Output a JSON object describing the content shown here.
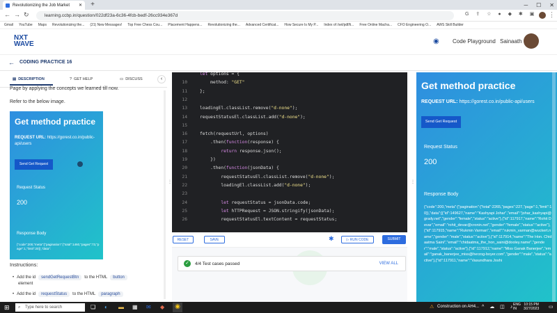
{
  "browser": {
    "tab_title": "Revolutionizing the Job Market",
    "url": "learning.ccbp.in/question/022df23a-6c36-4fcb-bedf-26cc934e367d",
    "bookmarks": [
      "Gmail",
      "YouTube",
      "Maps",
      "Revolutionizing the...",
      "(21) New Messages!",
      "Top Free Chess Cou...",
      "Placement Happens...",
      "Revolutionizing the...",
      "Advanced Certificat...",
      "How Secure Is My P...",
      "Index of /sel/pdf/li...",
      "Free Online Macha...",
      "CFO Engineering O...",
      "AWS Skill Builder"
    ]
  },
  "header": {
    "logo_top": "NXT",
    "logo_bottom": "WAVE",
    "code_playground": "Code Playground",
    "username": "Sainaath"
  },
  "practice_title": "CODING PRACTICE 16",
  "left_tabs": [
    "DESCRIPTION",
    "GET HELP",
    "DISCUSS"
  ],
  "left_panel": {
    "line1": "Page by applying the concepts we learned till now.",
    "line2": "Refer to the below image.",
    "preview": {
      "title": "Get method practice",
      "req_label": "REQUEST URL:",
      "req_url": "https://gorest.co.in/public-api/users",
      "button": "Send Get Request",
      "status_label": "Request Status",
      "status": "200",
      "body_label": "Response Body",
      "body": "{\"code\":200,\"meta\":{\"pagination\":{\"total\":1460,\"pages\":73,\"page\":1,\"limit\":20}},\"data\":"
    },
    "instructions_heading": "Instructions:",
    "inst1_a": "Add the id",
    "inst1_code": "sendGetRequestBtn",
    "inst1_b": "to the HTML",
    "inst1_code2": "button",
    "inst1_c": "element",
    "inst2_a": "Add the id",
    "inst2_code": "requestStatus",
    "inst2_b": "to the HTML",
    "inst2_code2": "paragraph"
  },
  "editor": {
    "lines": [
      {
        "n": "",
        "t": "let options = {"
      },
      {
        "n": "10",
        "t": "    method: \"GET\""
      },
      {
        "n": "11",
        "t": "};"
      },
      {
        "n": "12",
        "t": ""
      },
      {
        "n": "13",
        "t": "loadingEl.classList.remove(\"d-none\");"
      },
      {
        "n": "14",
        "t": "requestStatusEl.classList.add(\"d-none\");"
      },
      {
        "n": "15",
        "t": ""
      },
      {
        "n": "16",
        "t": "fetch(requestUrl, options)"
      },
      {
        "n": "17",
        "t": "    .then(function(response) {"
      },
      {
        "n": "18",
        "t": "        return response.json();"
      },
      {
        "n": "19",
        "t": "    })"
      },
      {
        "n": "20",
        "t": "    .then(function(jsonData) {"
      },
      {
        "n": "21",
        "t": "        requestStatusEl.classList.remove(\"d-none\");"
      },
      {
        "n": "22",
        "t": "        loadingEl.classList.add(\"d-none\");"
      },
      {
        "n": "23",
        "t": ""
      },
      {
        "n": "24",
        "t": "        let requestStatus = jsonData.code;"
      },
      {
        "n": "25",
        "t": "        let hTTPRequest = JSON.stringify(jsonData);"
      },
      {
        "n": "26",
        "t": "        requestStatusEl.textContent = requestStatus;"
      }
    ],
    "reset": "RESET",
    "save": "SAVE",
    "run": "RUN CODE",
    "submit": "SUBMIT"
  },
  "tests": {
    "text": "4/4 Test cases passed",
    "view_all": "VIEW ALL"
  },
  "right_preview": {
    "title": "Get method practice",
    "req_label": "REQUEST URL:",
    "req_url": "https://gorest.co.in/public-api/users",
    "button": "Send Get Request",
    "status_label": "Request Status",
    "status": "200",
    "body_label": "Response Body",
    "body": "{\"code\":200,\"meta\":{\"pagination\":{\"total\":2265,\"pages\":227,\"page\":1,\"limit\":10}},\"data\":[{\"id\":149627,\"name\":\"Kashyapi Johar\",\"email\":\"johar_kashyapi@grady.net\",\"gender\":\"female\",\"status\":\"active\"},{\"id\":117917,\"name\":\"Rohit Devar\",\"email\":\"rohit_devar@cronin.net\",\"gender\":\"female\",\"status\":\"active\"},{\"id\":117915,\"name\":\"Rukmin Varman\",\"email\":\"rukmin_varman@wuckert.name\",\"gender\":\"male\",\"status\":\"active\"},{\"id\":117914,\"name\":\"The Hon. Chidaatma Saini\",\"email\":\"chidaatma_the_hon_saini@dooley.name\",\"gender\":\"male\",\"status\":\"active\"},{\"id\":117912,\"name\":\"Miss Ganak Banerjee\",\"email\":\"ganak_banerjee_miss@herzog-boyer.com\",\"gender\":\"male\",\"status\":\"active\"},{\"id\":117911,\"name\":\"Vasundhara Joshi"
  },
  "taskbar": {
    "search": "Type here to search",
    "weather": "Construction on AH4...",
    "lang": "ENG",
    "region": "IN",
    "time": "10:15 PM",
    "date": "3/27/2023"
  }
}
